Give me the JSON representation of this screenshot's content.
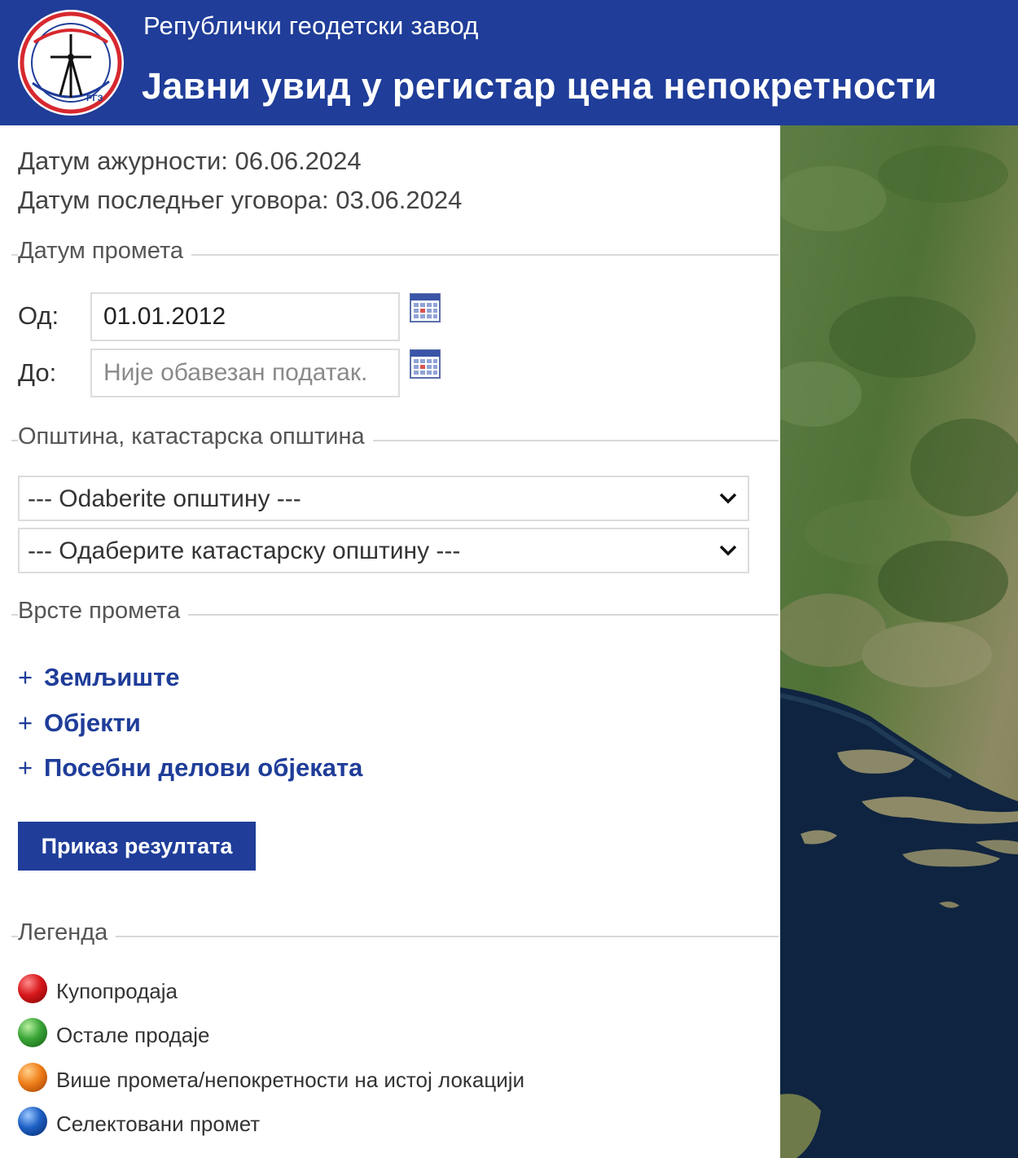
{
  "header": {
    "org_name": "Републички геодетски завод",
    "app_title": "Јавни увид у регистар цена непокретности",
    "logo_text": "РГЗ"
  },
  "info": {
    "update_date": "Датум ажурности: 06.06.2024",
    "last_contract_date": "Датум последњег уговора: 03.06.2024"
  },
  "date_section": {
    "title": "Датум промета",
    "from_label": "Од:",
    "from_value": "01.01.2012",
    "to_label": "До:",
    "to_placeholder": "Није обавезан податак."
  },
  "municipality_section": {
    "title": "Општина, катастарска општина",
    "municipality_select": "--- Odaberite општину ---",
    "cadastral_select": "--- Одаберите катастарску општину ---"
  },
  "transaction_types": {
    "title": "Врсте промета",
    "expand_symbol": "+",
    "items": [
      "Земљиште",
      "Објекти",
      "Посебни делови објеката"
    ]
  },
  "show_results_button": "Приказ резултата",
  "legend": {
    "title": "Легенда",
    "items": [
      {
        "label": "Купопродаја",
        "color": "#cc1f1f"
      },
      {
        "label": "Остале продаје",
        "color": "#3aa537"
      },
      {
        "label": "Више промета/непокретности на истој локацији",
        "color": "#f07f1a"
      },
      {
        "label": "Селектовани промет",
        "color": "#1d5fc4"
      }
    ]
  },
  "colors": {
    "brand_blue": "#1f3d99",
    "map_land": "#5b7a3e",
    "map_sea": "#0f2440"
  }
}
